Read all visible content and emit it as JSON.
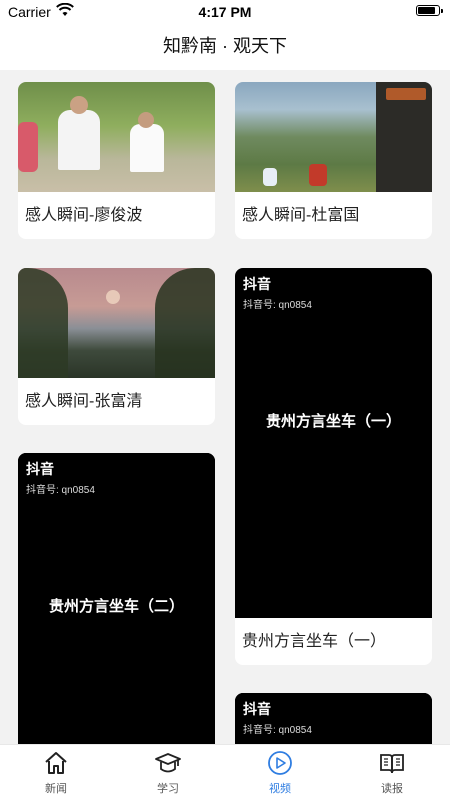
{
  "status": {
    "carrier": "Carrier",
    "time": "4:17 PM"
  },
  "nav": {
    "title": "知黔南 · 观天下"
  },
  "videos": [
    {
      "title": "感人瞬间-廖俊波"
    },
    {
      "title": "感人瞬间-杜富国"
    },
    {
      "title": "感人瞬间-张富清"
    },
    {
      "title": "贵州方言坐车（一）",
      "douyin": "抖音",
      "douyin_id": "抖音号: qn0854",
      "overlay": "贵州方言坐车（一）"
    },
    {
      "douyin": "抖音",
      "douyin_id": "抖音号: qn0854",
      "overlay": "贵州方言坐车（二）"
    },
    {
      "douyin": "抖音",
      "douyin_id": "抖音号: qn0854"
    }
  ],
  "tabs": [
    {
      "label": "新闻",
      "icon": "home-icon"
    },
    {
      "label": "学习",
      "icon": "graduation-cap-icon"
    },
    {
      "label": "视频",
      "icon": "play-circle-icon",
      "active": true
    },
    {
      "label": "读报",
      "icon": "open-book-icon"
    }
  ],
  "colors": {
    "accent": "#2f7de1",
    "background": "#f2f2f2"
  }
}
